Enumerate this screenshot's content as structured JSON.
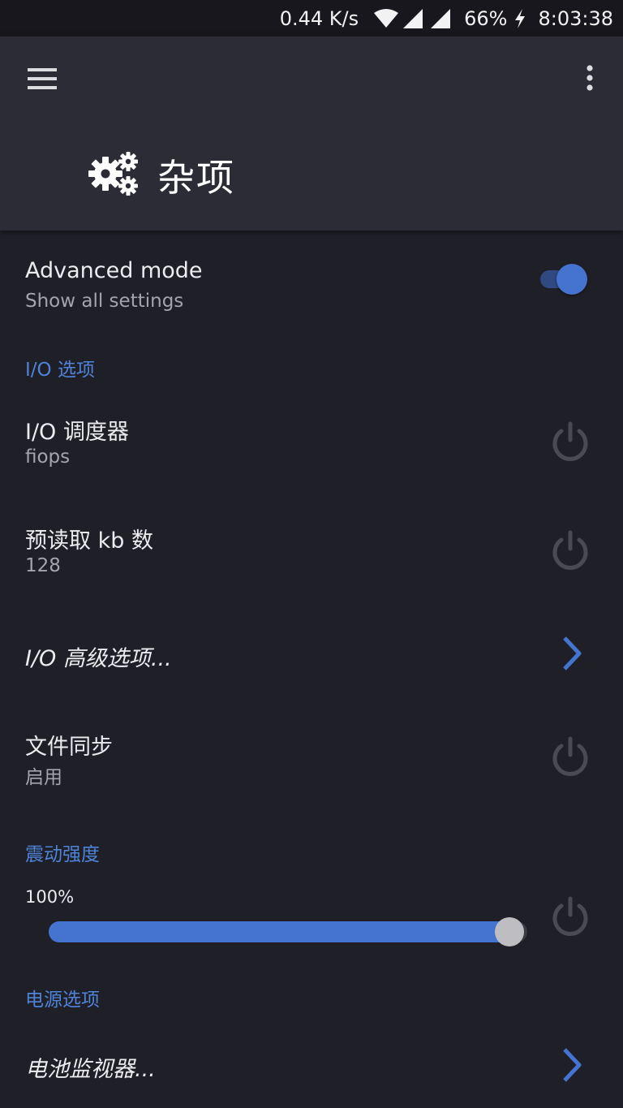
{
  "status_bar": {
    "net_speed": "0.44 K/s",
    "battery": "66%",
    "time": "8:03:38",
    "icons": [
      "wifi-icon",
      "signal-icon",
      "signal-icon",
      "charging-icon"
    ]
  },
  "app_bar": {
    "title": "杂项",
    "title_icon": "gears-icon",
    "menu_icon": "hamburger-menu-icon",
    "overflow_icon": "more-vert-icon"
  },
  "colors": {
    "accent": "#4474cf",
    "background": "#1f1f27",
    "app_bar": "#2c2c37",
    "section_header": "#4f83d7",
    "secondary_text": "#a4a4ab"
  },
  "settings": {
    "advanced_mode": {
      "title": "Advanced mode",
      "summary": "Show all settings",
      "enabled": true
    },
    "io_section": "I/O 选项",
    "io_scheduler": {
      "title": "I/O 调度器",
      "summary": "fiops"
    },
    "read_ahead": {
      "title": "预读取 kb 数",
      "summary": "128"
    },
    "io_advanced": {
      "title": "I/O 高级选项..."
    },
    "fsync": {
      "title": "文件同步",
      "summary": "启用"
    },
    "vibration_section": "震动强度",
    "vibration": {
      "value_label": "100%",
      "level": 1.0
    },
    "power_section": "电源选项",
    "battery_monitor": {
      "title": "电池监视器..."
    }
  }
}
